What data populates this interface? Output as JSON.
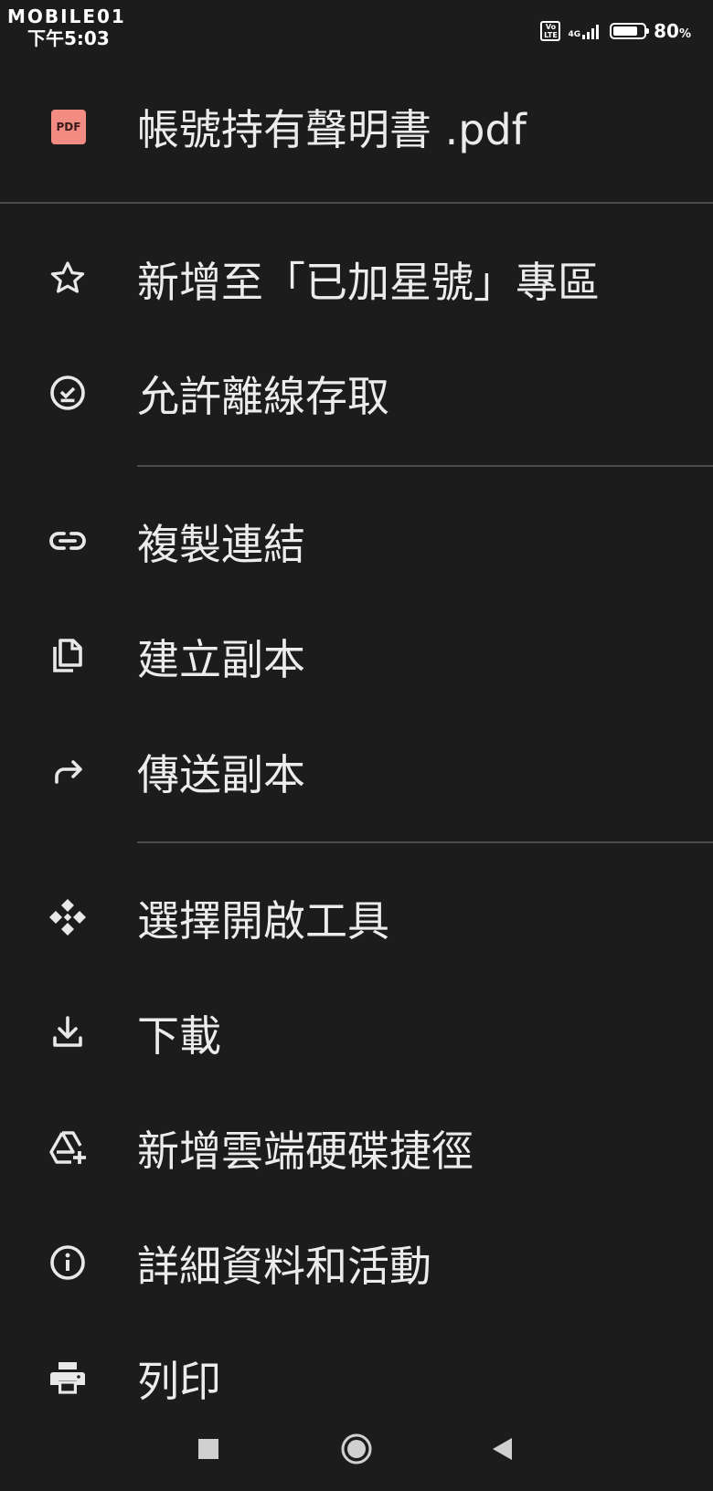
{
  "status_bar": {
    "watermark": "MOBILE01",
    "time": "下午5:03",
    "volte": "Vo LTE",
    "network": "4G",
    "battery_percent": "80",
    "battery_level": 0.8
  },
  "header": {
    "file_badge": "PDF",
    "file_name": "帳號持有聲明書 .pdf"
  },
  "menu": {
    "items": [
      {
        "label": "新增至「已加星號」專區",
        "icon": "star-outline-icon"
      },
      {
        "label": "允許離線存取",
        "icon": "offline-check-icon"
      },
      {
        "label": "複製連結",
        "icon": "link-icon"
      },
      {
        "label": "建立副本",
        "icon": "copy-icon"
      },
      {
        "label": "傳送副本",
        "icon": "forward-arrow-icon"
      },
      {
        "label": "選擇開啟工具",
        "icon": "open-with-icon"
      },
      {
        "label": "下載",
        "icon": "download-icon"
      },
      {
        "label": "新增雲端硬碟捷徑",
        "icon": "drive-add-shortcut-icon"
      },
      {
        "label": "詳細資料和活動",
        "icon": "info-icon"
      },
      {
        "label": "列印",
        "icon": "print-icon"
      }
    ]
  },
  "colors": {
    "background": "#1c1c1d",
    "text": "#ececec",
    "divider": "#4a4a4b",
    "pdf_badge": "#f28b82"
  }
}
